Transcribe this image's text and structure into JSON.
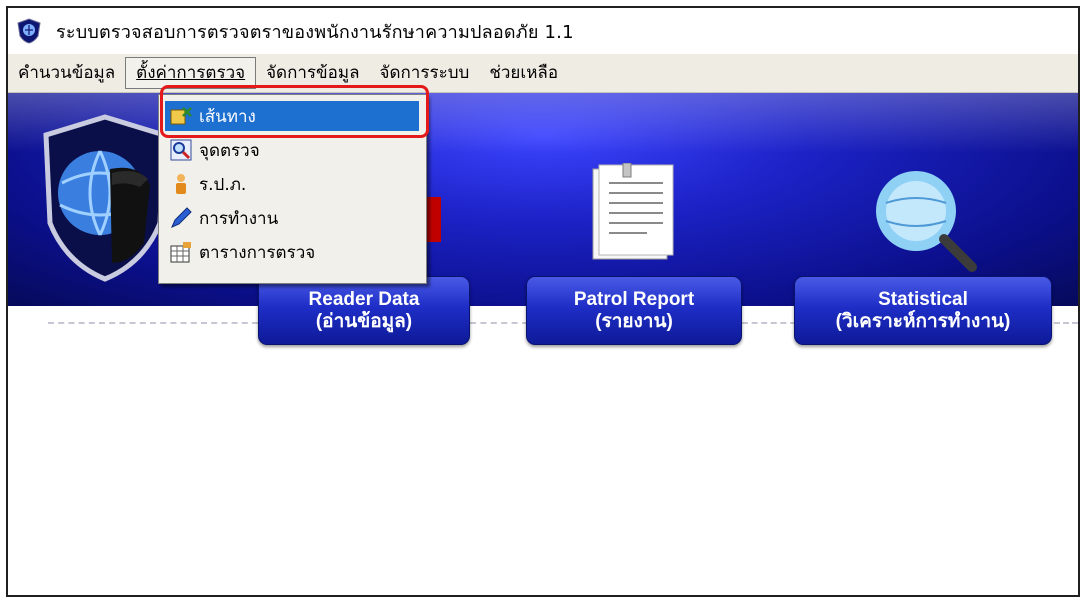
{
  "window": {
    "title": "ระบบตรวจสอบการตรวจตราของพนักงานรักษาความปลอดภัย 1.1",
    "icon": "shield-app-icon"
  },
  "menubar": {
    "items": [
      {
        "label": "คำนวนข้อมูล"
      },
      {
        "label": "ตั้งค่าการตรวจ",
        "active": true
      },
      {
        "label": "จัดการข้อมูล"
      },
      {
        "label": "จัดการระบบ"
      },
      {
        "label": "ช่วยเหลือ"
      }
    ]
  },
  "dropdown": {
    "items": [
      {
        "label": "เส้นทาง",
        "icon": "route-tools-icon",
        "selected": true
      },
      {
        "label": "จุดตรวจ",
        "icon": "checkpoint-magnifier-icon"
      },
      {
        "label": "ร.ป.ภ.",
        "icon": "guard-person-icon"
      },
      {
        "label": "การทำงาน",
        "icon": "pen-icon"
      },
      {
        "label": "ตารางการตรวจ",
        "icon": "schedule-table-icon"
      }
    ]
  },
  "banner": {
    "buttons": [
      {
        "line1": "Reader Data",
        "line2": "(อ่านข้อมูล)"
      },
      {
        "line1": "Patrol Report",
        "line2": "(รายงาน)"
      },
      {
        "line1": "Statistical",
        "line2": "(วิเคราะห์การทำงาน)"
      }
    ]
  },
  "colors": {
    "banner_blue": "#1c22c6",
    "highlight_red": "#e41a1a",
    "menu_selection": "#1d6fd0"
  }
}
